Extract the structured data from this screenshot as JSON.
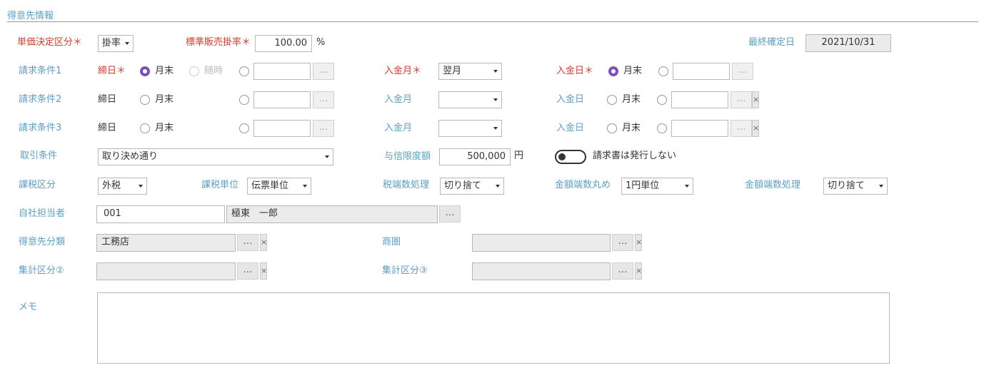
{
  "section": {
    "title": "得意先情報"
  },
  "row_price": {
    "tanka_label": "単価決定区分＊",
    "tanka_value": "掛率",
    "hyojun_label": "標準販売掛率＊",
    "hyojun_value": "100.00",
    "hyojun_unit": "%",
    "saishu_label": "最終確定日",
    "saishu_value": "2021/10/31"
  },
  "billing1": {
    "label": "請求条件1",
    "shime_label": "締日＊",
    "opt_getsumatsu": "月末",
    "opt_zuiji": "随時",
    "nyukin_tsuki_label": "入金月＊",
    "nyukin_tsuki_value": "翌月",
    "nyukin_hi_label": "入金日＊",
    "nyukin_hi_opt": "月末"
  },
  "billing2": {
    "label": "請求条件2",
    "shime_label": "締日",
    "opt_getsumatsu": "月末",
    "nyukin_tsuki_label": "入金月",
    "nyukin_tsuki_value": "",
    "nyukin_hi_label": "入金日",
    "nyukin_hi_opt": "月末"
  },
  "billing3": {
    "label": "請求条件3",
    "shime_label": "締日",
    "opt_getsumatsu": "月末",
    "nyukin_tsuki_label": "入金月",
    "nyukin_tsuki_value": "",
    "nyukin_hi_label": "入金日",
    "nyukin_hi_opt": "月末"
  },
  "trade": {
    "label": "取引条件",
    "value": "取り決め通り",
    "credit_label": "与信限度額",
    "credit_value": "500,000",
    "credit_unit": "円",
    "toggle_label": "請求書は発行しない"
  },
  "tax": {
    "kubun_label": "課税区分",
    "kubun_value": "外税",
    "tani_label": "課税単位",
    "tani_value": "伝票単位",
    "zeihasu_label": "税端数処理",
    "zeihasu_value": "切り捨て",
    "marume_label": "金額端数丸め",
    "marume_value": "1円単位",
    "kingaku_label": "金額端数処理",
    "kingaku_value": "切り捨て"
  },
  "staff": {
    "label": "自社担当者",
    "code": "001",
    "name": "極東　一郎"
  },
  "class": {
    "bunrui_label": "得意先分類",
    "bunrui_value": "工務店",
    "shoken_label": "商圏",
    "shoken_value": "",
    "shukei2_label": "集計区分②",
    "shukei2_value": "",
    "shukei3_label": "集計区分③",
    "shukei3_value": ""
  },
  "memo": {
    "label": "メモ",
    "value": ""
  },
  "icons": {
    "ellipsis": "…",
    "clear": "×"
  },
  "colors": {
    "label_blue": "#5b9fc5",
    "required_red": "#d93a2b",
    "radio_checked": "#7a4fc0"
  }
}
